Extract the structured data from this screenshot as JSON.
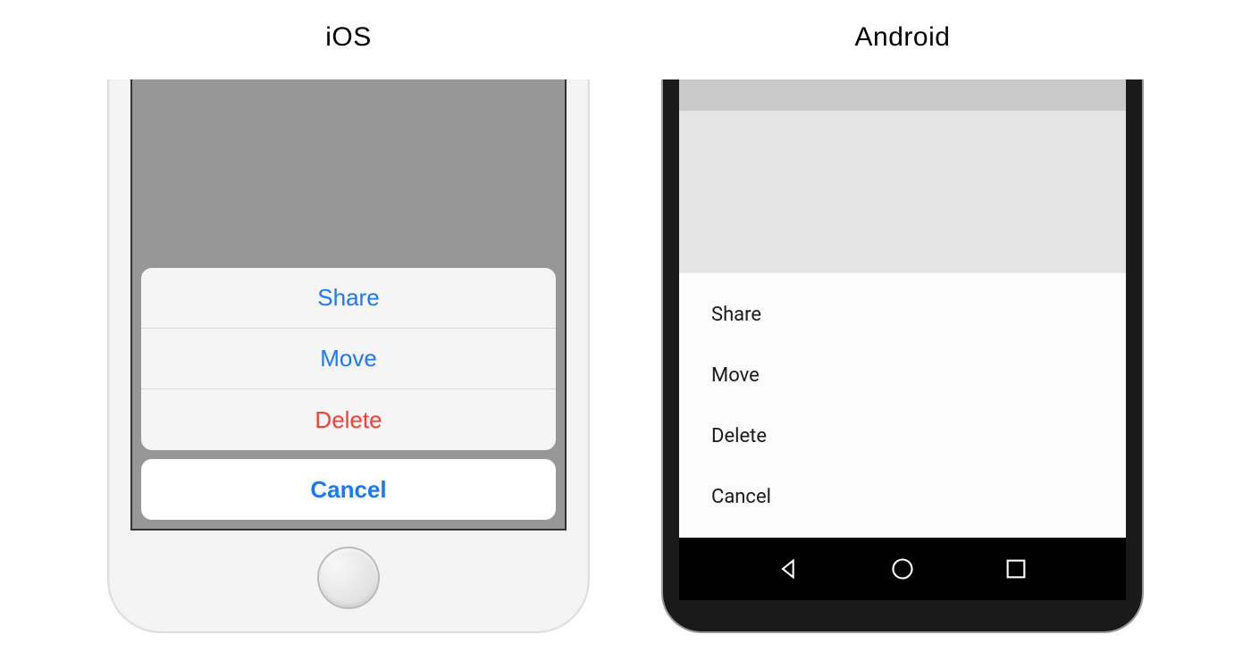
{
  "ios": {
    "title": "iOS",
    "actions": [
      {
        "label": "Share",
        "destructive": false
      },
      {
        "label": "Move",
        "destructive": false
      },
      {
        "label": "Delete",
        "destructive": true
      }
    ],
    "cancel_label": "Cancel"
  },
  "android": {
    "title": "Android",
    "actions": [
      {
        "label": "Share"
      },
      {
        "label": "Move"
      },
      {
        "label": "Delete"
      },
      {
        "label": "Cancel"
      }
    ]
  }
}
